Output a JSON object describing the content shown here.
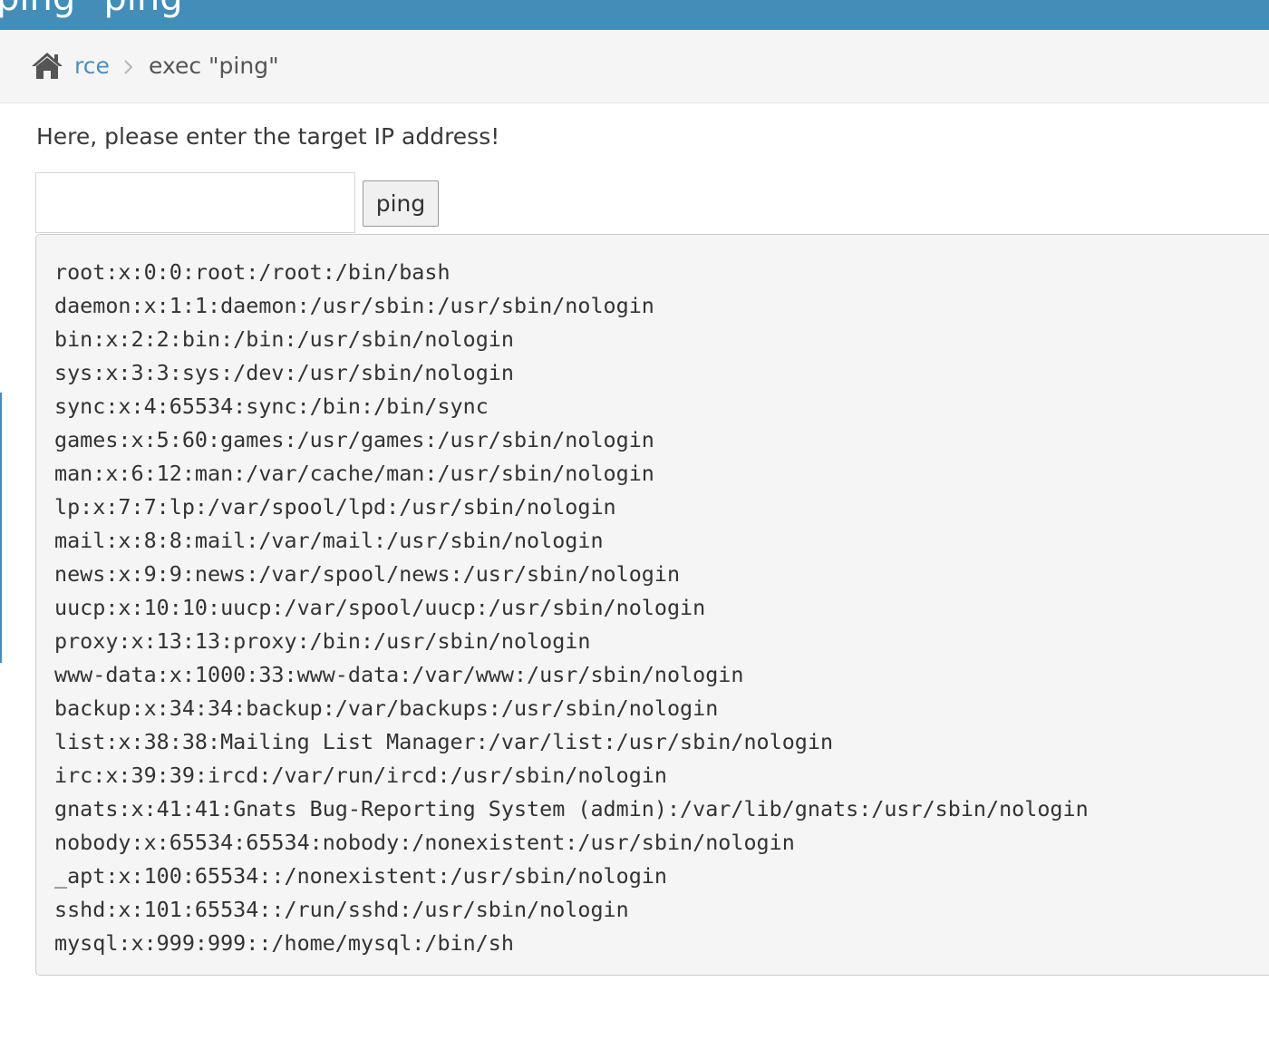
{
  "header": {
    "title": "ping \"ping\""
  },
  "breadcrumb": {
    "home_icon": "home-icon",
    "parent_label": "rce",
    "separator_icon": "chevron-right-icon",
    "current_label": "exec \"ping\""
  },
  "form": {
    "prompt": "Here, please enter the target IP address!",
    "ip_value": "",
    "ping_label": "ping"
  },
  "output": {
    "lines": [
      "root:x:0:0:root:/root:/bin/bash",
      "daemon:x:1:1:daemon:/usr/sbin:/usr/sbin/nologin",
      "bin:x:2:2:bin:/bin:/usr/sbin/nologin",
      "sys:x:3:3:sys:/dev:/usr/sbin/nologin",
      "sync:x:4:65534:sync:/bin:/bin/sync",
      "games:x:5:60:games:/usr/games:/usr/sbin/nologin",
      "man:x:6:12:man:/var/cache/man:/usr/sbin/nologin",
      "lp:x:7:7:lp:/var/spool/lpd:/usr/sbin/nologin",
      "mail:x:8:8:mail:/var/mail:/usr/sbin/nologin",
      "news:x:9:9:news:/var/spool/news:/usr/sbin/nologin",
      "uucp:x:10:10:uucp:/var/spool/uucp:/usr/sbin/nologin",
      "proxy:x:13:13:proxy:/bin:/usr/sbin/nologin",
      "www-data:x:1000:33:www-data:/var/www:/usr/sbin/nologin",
      "backup:x:34:34:backup:/var/backups:/usr/sbin/nologin",
      "list:x:38:38:Mailing List Manager:/var/list:/usr/sbin/nologin",
      "irc:x:39:39:ircd:/var/run/ircd:/usr/sbin/nologin",
      "gnats:x:41:41:Gnats Bug-Reporting System (admin):/var/lib/gnats:/usr/sbin/nologin",
      "nobody:x:65534:65534:nobody:/nonexistent:/usr/sbin/nologin",
      "_apt:x:100:65534::/nonexistent:/usr/sbin/nologin",
      "sshd:x:101:65534::/run/sshd:/usr/sbin/nologin",
      "mysql:x:999:999::/home/mysql:/bin/sh"
    ]
  },
  "colors": {
    "header_bg": "#438eb9",
    "link": "#4c8fbd",
    "output_bg": "#f5f5f5"
  }
}
